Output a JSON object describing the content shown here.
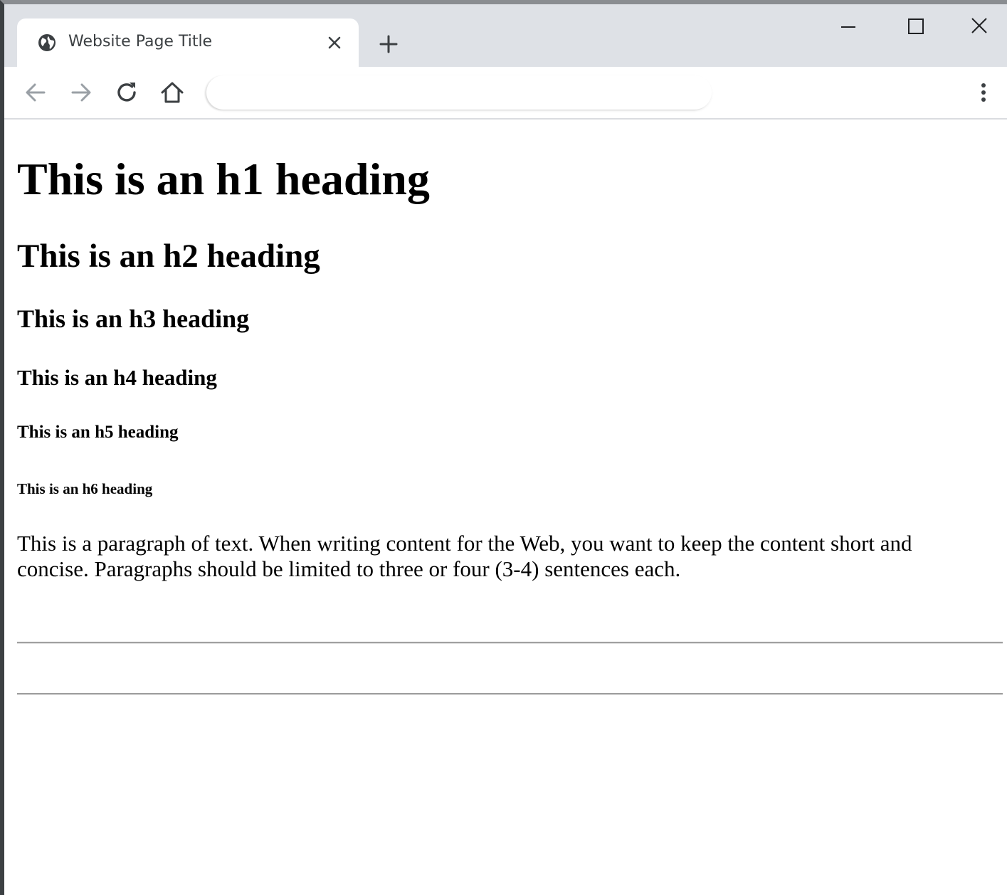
{
  "browser": {
    "tab": {
      "title": "Website Page Title",
      "favicon_icon": "globe-icon",
      "close_icon": "close-icon"
    },
    "new_tab_icon": "plus-icon",
    "window_controls": {
      "minimize_icon": "minimize-icon",
      "maximize_icon": "maximize-icon",
      "close_icon": "close-icon"
    },
    "toolbar": {
      "back_icon": "arrow-left-icon",
      "forward_icon": "arrow-right-icon",
      "reload_icon": "reload-icon",
      "home_icon": "home-icon",
      "address_value": "",
      "menu_icon": "kebab-menu-icon"
    }
  },
  "page": {
    "h1": "This is an h1 heading",
    "h2": "This is an h2 heading",
    "h3": "This is an h3 heading",
    "h4": "This is an h4 heading",
    "h5": "This is an h5 heading",
    "h6": "This is an h6 heading",
    "paragraph": "This is a paragraph of text. When writing content for the Web, you want to keep the content short and concise. Paragraphs should be limited to three or four (3-4) sentences each."
  },
  "colors": {
    "tabstrip_bg": "#dee1e6",
    "tab_bg": "#ffffff",
    "icon_color": "#3c4043",
    "icon_disabled": "#9aa0a6",
    "hr_color": "#a0a0a0"
  }
}
